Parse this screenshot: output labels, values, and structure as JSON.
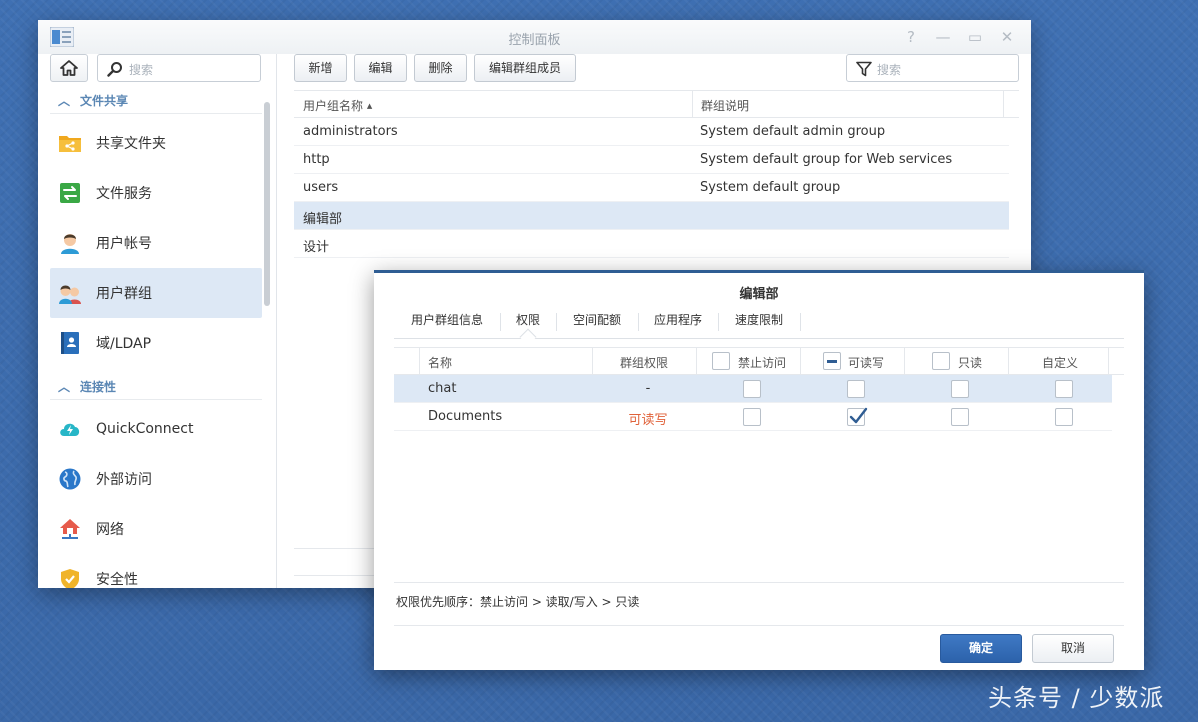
{
  "window": {
    "title": "控制面板",
    "controls": [
      "?",
      "—",
      "▭",
      "✕"
    ]
  },
  "sidebar": {
    "search_placeholder": "搜索",
    "sections": [
      {
        "title": "文件共享",
        "items": [
          {
            "label": "共享文件夹",
            "icon": "shared-folder-icon"
          },
          {
            "label": "文件服务",
            "icon": "file-services-icon"
          },
          {
            "label": "用户帐号",
            "icon": "user-account-icon"
          },
          {
            "label": "用户群组",
            "icon": "user-group-icon",
            "active": true
          },
          {
            "label": "域/LDAP",
            "icon": "domain-ldap-icon"
          }
        ]
      },
      {
        "title": "连接性",
        "items": [
          {
            "label": "QuickConnect",
            "icon": "quickconnect-icon"
          },
          {
            "label": "外部访问",
            "icon": "external-access-icon"
          },
          {
            "label": "网络",
            "icon": "network-icon"
          },
          {
            "label": "安全性",
            "icon": "security-icon"
          }
        ]
      }
    ]
  },
  "toolbar": {
    "add_label": "新增",
    "edit_label": "编辑",
    "delete_label": "删除",
    "edit_members_label": "编辑群组成员",
    "filter_placeholder": "搜索"
  },
  "groups_table": {
    "columns": [
      "用户组名称",
      "群组说明"
    ],
    "sort_indicator": "▲",
    "rows": [
      {
        "name": "administrators",
        "description": "System default admin group"
      },
      {
        "name": "http",
        "description": "System default group for Web services"
      },
      {
        "name": "users",
        "description": "System default group"
      },
      {
        "name": "编辑部",
        "description": "",
        "selected": true
      },
      {
        "name": "设计",
        "description": ""
      }
    ]
  },
  "dialog": {
    "title": "编辑部",
    "tabs": [
      "用户群组信息",
      "权限",
      "空间配额",
      "应用程序",
      "速度限制"
    ],
    "active_tab": "权限",
    "columns": {
      "name": "名称",
      "group_permission": "群组权限",
      "no_access": "禁止访问",
      "read_write": "可读写",
      "read_only": "只读",
      "custom": "自定义"
    },
    "header_checkboxes": {
      "no_access": "unchecked",
      "read_write": "partial",
      "read_only": "unchecked"
    },
    "rows": [
      {
        "name": "chat",
        "group_permission": "-",
        "no_access": false,
        "read_write": false,
        "read_only": false,
        "custom": false,
        "selected": true
      },
      {
        "name": "Documents",
        "group_permission": "可读写",
        "no_access": false,
        "read_write": true,
        "read_only": false,
        "custom": false
      }
    ],
    "permission_color": "#e0623a",
    "priority_text": "权限优先顺序：禁止访问 > 读取/写入 > 只读",
    "ok_label": "确定",
    "cancel_label": "取消"
  },
  "watermark": "头条号 / 少数派",
  "colors": {
    "accent": "#2f5d93",
    "selected_row": "#dde8f5",
    "section_title": "#5b87b4",
    "desktop": "#3b6bad"
  }
}
